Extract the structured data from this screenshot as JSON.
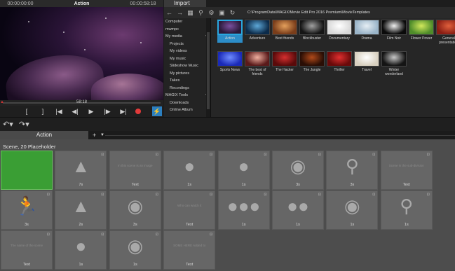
{
  "preview": {
    "time_left": "00:00:00:00",
    "title": "Action",
    "time_right": "00:00:58:18",
    "scrub_mid": "58:18",
    "controls": {
      "mark_in": "[",
      "mark_out": "]",
      "to_start": "|◀",
      "prev": "◀|",
      "play": "▶",
      "next": "|▶",
      "to_end": "▶|",
      "flash": "⚡"
    }
  },
  "import": {
    "tab_label": "Import",
    "path": "C:\\ProgramData\\MAGIX\\Movie Edit Pro 2016 Premium\\MovieTemplates",
    "tree": [
      {
        "label": "Computer",
        "sub": false,
        "arrow": ""
      },
      {
        "label": "mwmpc",
        "sub": false,
        "arrow": ""
      },
      {
        "label": "My media",
        "sub": false,
        "arrow": "▾"
      },
      {
        "label": "Projects",
        "sub": true,
        "arrow": ""
      },
      {
        "label": "My videos",
        "sub": true,
        "arrow": ""
      },
      {
        "label": "My music",
        "sub": true,
        "arrow": ""
      },
      {
        "label": "Slideshow Music",
        "sub": true,
        "arrow": ""
      },
      {
        "label": "My pictures",
        "sub": true,
        "arrow": ""
      },
      {
        "label": "Takes",
        "sub": true,
        "arrow": ""
      },
      {
        "label": "Recordings",
        "sub": true,
        "arrow": ""
      },
      {
        "label": "MAGIX Tools",
        "sub": false,
        "arrow": "▾"
      },
      {
        "label": "Downloads",
        "sub": true,
        "arrow": ""
      },
      {
        "label": "Online Album",
        "sub": true,
        "arrow": ""
      }
    ],
    "templates": [
      {
        "label": "Action",
        "color": "#2b1a3a",
        "color2": "#7a4f9e"
      },
      {
        "label": "Adventure",
        "color": "#0c2b4a",
        "color2": "#5ea8d8"
      },
      {
        "label": "Best friends",
        "color": "#7a3d1a",
        "color2": "#e4a05c"
      },
      {
        "label": "Blockbuster",
        "color": "#151515",
        "color2": "#a0a0a0"
      },
      {
        "label": "Documentary",
        "color": "#d8d8d8",
        "color2": "#ffffff"
      },
      {
        "label": "Drama",
        "color": "#9ab4c8",
        "color2": "#e6eef4"
      },
      {
        "label": "Film Noir",
        "color": "#0a0a0a",
        "color2": "#efefef"
      },
      {
        "label": "Flower Power",
        "color": "#4e8c2a",
        "color2": "#d1e85c"
      },
      {
        "label": "General presentation",
        "color": "#8a1e14",
        "color2": "#e0603c"
      },
      {
        "label": "Sports News",
        "color": "#1a2ab8",
        "color2": "#6f8cff"
      },
      {
        "label": "The best of friends",
        "color": "#5a1a1a",
        "color2": "#f0b0a0"
      },
      {
        "label": "The Hacker",
        "color": "#5a0a0a",
        "color2": "#d43030"
      },
      {
        "label": "The Jungle",
        "color": "#2a0e05",
        "color2": "#b04a1a"
      },
      {
        "label": "Thriller",
        "color": "#6a0a0a",
        "color2": "#e03030"
      },
      {
        "label": "Travel",
        "color": "#d8d0c0",
        "color2": "#ffffff"
      },
      {
        "label": "Winter wonderland",
        "color": "#141414",
        "color2": "#c8c8c8"
      }
    ]
  },
  "storyboard": {
    "tab_label": "Action",
    "caption": "Scene, 20 Placeholder",
    "clips": [
      {
        "icon": "",
        "icon_name": "",
        "text": "",
        "dur": "",
        "green": true
      },
      {
        "icon": "▲",
        "icon_name": "tree-icon",
        "text": "",
        "dur": "7s",
        "green": false
      },
      {
        "icon": "",
        "icon_name": "",
        "text": "In this scene is an image",
        "dur": "Text",
        "green": false
      },
      {
        "icon": "●",
        "icon_name": "single-person-icon",
        "text": "",
        "dur": "1s",
        "green": false
      },
      {
        "icon": "●",
        "icon_name": "single-person-icon",
        "text": "",
        "dur": "1s",
        "green": false
      },
      {
        "icon": "◉",
        "icon_name": "person-portrait-icon",
        "text": "",
        "dur": "3s",
        "green": false
      },
      {
        "icon": "⚲",
        "icon_name": "magnifier-icon",
        "text": "",
        "dur": "3s",
        "green": false
      },
      {
        "icon": "",
        "icon_name": "",
        "text": "Scene in the sub-division",
        "dur": "Text",
        "green": false
      },
      {
        "icon": "🏃",
        "icon_name": "running-person-icon",
        "text": "",
        "dur": "3s",
        "green": false
      },
      {
        "icon": "▲",
        "icon_name": "tree-icon",
        "text": "",
        "dur": "2s",
        "green": false
      },
      {
        "icon": "◉",
        "icon_name": "person-portrait-icon",
        "text": "",
        "dur": "3s",
        "green": false
      },
      {
        "icon": "",
        "icon_name": "",
        "text": "Who can watch it",
        "dur": "Text",
        "green": false
      },
      {
        "icon": "●●●",
        "icon_name": "group-icon",
        "text": "",
        "dur": "1s",
        "green": false
      },
      {
        "icon": "●●",
        "icon_name": "pair-icon",
        "text": "",
        "dur": "1s",
        "green": false
      },
      {
        "icon": "◉",
        "icon_name": "person-portrait-icon",
        "text": "",
        "dur": "1s",
        "green": false
      },
      {
        "icon": "⚲",
        "icon_name": "magnifier-icon",
        "text": "",
        "dur": "1s",
        "green": false
      },
      {
        "icon": "",
        "icon_name": "",
        "text": "The name of the scene",
        "dur": "Text",
        "green": false
      },
      {
        "icon": "●",
        "icon_name": "single-person-icon",
        "text": "",
        "dur": "1s",
        "green": false
      },
      {
        "icon": "◉",
        "icon_name": "person-portrait-icon",
        "text": "",
        "dur": "1s",
        "green": false
      },
      {
        "icon": "",
        "icon_name": "",
        "text": "SOME HERE  Added to",
        "dur": "Text",
        "green": false
      }
    ]
  }
}
